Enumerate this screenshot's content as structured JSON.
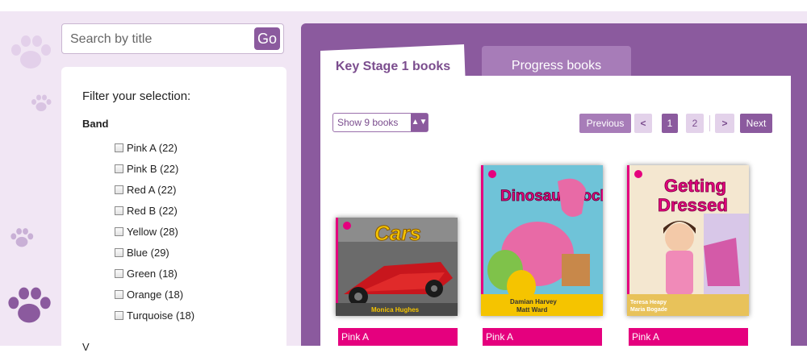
{
  "search": {
    "placeholder": "Search by title",
    "go_label": "Go"
  },
  "filter": {
    "title": "Filter your selection:",
    "band_heading": "Band",
    "bands": [
      {
        "label": "Pink A (22)"
      },
      {
        "label": "Pink B (22)"
      },
      {
        "label": "Red A (22)"
      },
      {
        "label": "Red B (22)"
      },
      {
        "label": "Yellow (28)"
      },
      {
        "label": "Blue (29)"
      },
      {
        "label": "Green (18)"
      },
      {
        "label": "Orange (18)"
      },
      {
        "label": "Turquoise (18)"
      }
    ],
    "next_section_partial": "V"
  },
  "tabs": [
    {
      "label": "Key Stage 1 books",
      "active": true
    },
    {
      "label": "Progress books",
      "active": false
    }
  ],
  "show_select": {
    "value": "Show 9 books"
  },
  "pagination": {
    "previous": "Previous",
    "left": "<",
    "pages": [
      "1",
      "2"
    ],
    "current": "1",
    "right": ">",
    "next": "Next"
  },
  "books": [
    {
      "title": "Cars",
      "author": "Monica Hughes",
      "band": "Pink A",
      "band_color": "#e5007e"
    },
    {
      "title": "Dinosaur Rock",
      "author_line1": "Damian Harvey",
      "author_line2": "Matt Ward",
      "band": "Pink A",
      "band_color": "#e5007e"
    },
    {
      "title_line1": "Getting",
      "title_line2": "Dressed",
      "author_line1": "Teresa Heapy",
      "author_line2": "Maria Bogade",
      "band": "Pink A",
      "band_color": "#e5007e"
    }
  ],
  "colors": {
    "brand_purple": "#8b5a9e",
    "light_purple": "#f1e6f4",
    "pink_band": "#e5007e"
  }
}
